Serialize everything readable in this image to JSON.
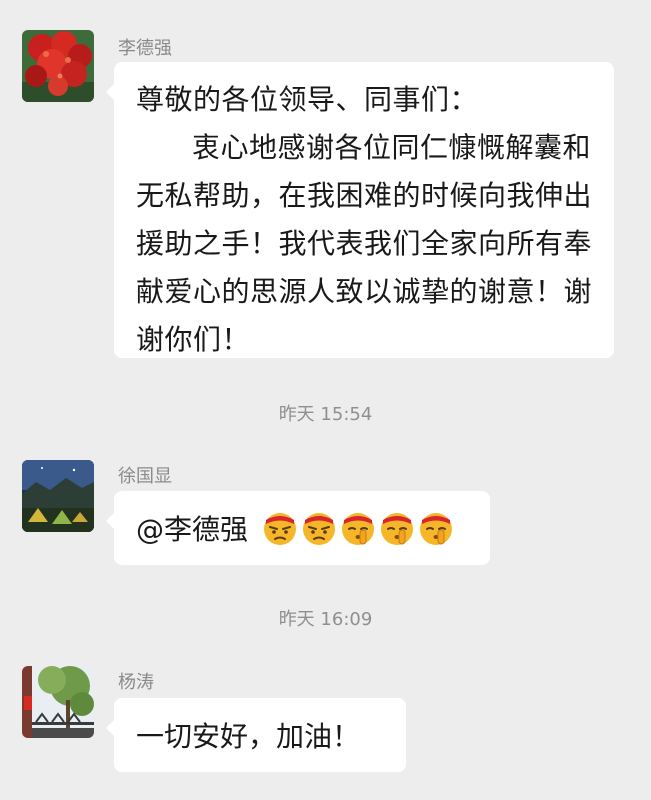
{
  "messages": [
    {
      "sender": "李德强",
      "avatar_icon": "avatar-red-flower-tree-icon",
      "greeting": "尊敬的各位领导、同事们：",
      "body": "衷心地感谢各位同仁慷慨解囊和无私帮助，在我困难的时候向我伸出援助之手！我代表我们全家向所有奉献爱心的思源人致以诚挚的谢意！谢谢你们！"
    },
    {
      "sender": "徐国显",
      "avatar_icon": "avatar-campsite-tents-icon",
      "mention": "@李德强",
      "emojis": [
        "angry-emoji-icon",
        "angry-emoji-icon",
        "shush-emoji-icon",
        "shush-emoji-icon",
        "shush-emoji-icon"
      ]
    },
    {
      "sender": "杨涛",
      "avatar_icon": "avatar-tree-bridge-icon",
      "text": "一切安好，加油！"
    }
  ],
  "timestamps": [
    "昨天 15:54",
    "昨天 16:09"
  ],
  "colors": {
    "background": "#ededed",
    "bubble": "#ffffff",
    "sender_name": "#8a8a8a",
    "timestamp": "#8f8f8f"
  }
}
